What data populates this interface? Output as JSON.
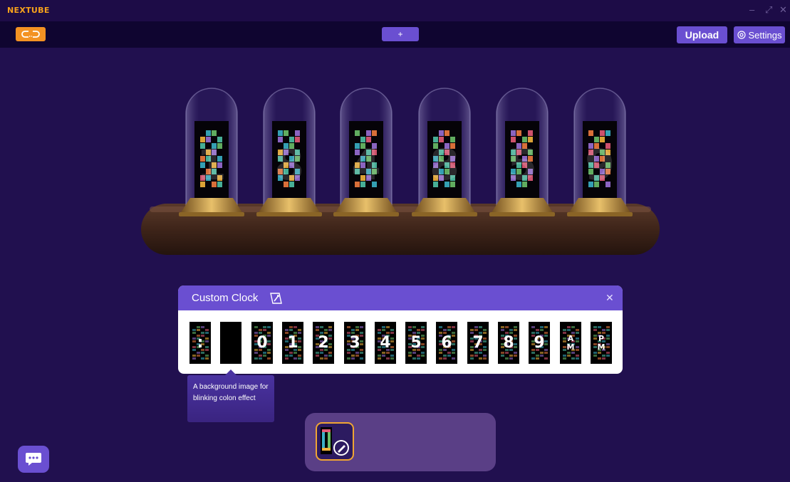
{
  "window": {
    "title": "NEXTUBE",
    "controls": [
      "minimize-icon",
      "restore-icon",
      "close-icon"
    ]
  },
  "toolbar": {
    "link_icon": "link-icon",
    "add_label": "+",
    "upload_label": "Upload",
    "settings_label": "Settings",
    "settings_icon": "gear-icon"
  },
  "clock": {
    "digits": [
      "1",
      "8",
      "4",
      "8",
      "5",
      "9"
    ]
  },
  "panel": {
    "title": "Custom Clock",
    "edit_icon": "edit-icon",
    "close_icon": "close-icon",
    "tiles": [
      ":",
      "",
      "0",
      "1",
      "2",
      "3",
      "4",
      "5",
      "6",
      "7",
      "8",
      "9",
      "AM",
      "PM"
    ]
  },
  "tooltip": {
    "text": "A background image for blinking colon effect"
  },
  "dock": {
    "item_icon": "custom-theme-icon",
    "item_badge_icon": "edit-icon"
  },
  "chat": {
    "icon": "chat-icon"
  },
  "colors": {
    "background": "#21104f",
    "toolbar": "#0f0530",
    "accent": "#6a4fd1",
    "brand": "#f7a21b",
    "link_button": "#f39223"
  }
}
